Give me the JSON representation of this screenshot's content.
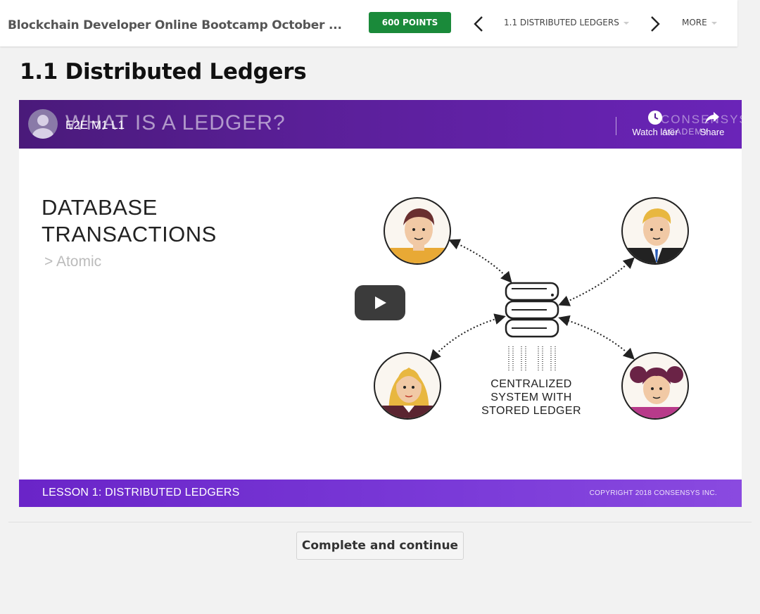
{
  "header": {
    "course_title": "Blockchain Developer Online Bootcamp October ...",
    "points_label": "600 POINTS",
    "lesson_nav_label": "1.1 DISTRIBUTED LEDGERS",
    "more_label": "MORE"
  },
  "page": {
    "title": "1.1 Distributed Ledgers"
  },
  "video": {
    "channel_label": "E2E M1 L1",
    "slide_title": "WHAT IS A LEDGER?",
    "brand_top": "CONSENSYS",
    "brand_bottom": "ACADEMY",
    "watch_later_label": "Watch later",
    "share_label": "Share",
    "slide_heading_line1": "DATABASE",
    "slide_heading_line2": "TRANSACTIONS",
    "slide_bullet": "> Atomic",
    "diagram_label_line1": "CENTRALIZED",
    "diagram_label_line2": "SYSTEM WITH",
    "diagram_label_line3": "STORED LEDGER",
    "lesson_label": "LESSON 1: DISTRIBUTED LEDGERS",
    "copyright": "COPYRIGHT 2018 CONSENSYS INC."
  },
  "footer": {
    "complete_label": "Complete and continue"
  },
  "colors": {
    "points_green": "#1a8a3a",
    "video_purple": "#5a1f98"
  }
}
